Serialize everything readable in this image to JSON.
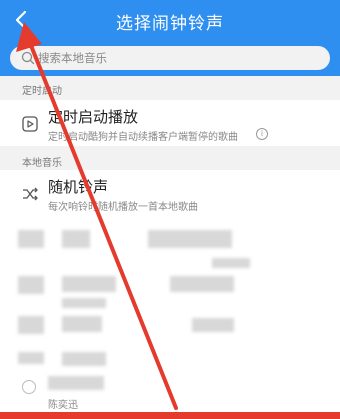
{
  "header": {
    "title": "选择闹钟铃声",
    "back_icon": "chevron-left-icon"
  },
  "search": {
    "placeholder": "搜索本地音乐",
    "icon": "search-icon"
  },
  "sections": {
    "timer": {
      "title": "定时启动",
      "item_title": "定时启动播放",
      "item_sub": "定时启动酷狗并自动续播客户端暂停的歌曲",
      "icon": "timer-play-icon",
      "info_icon": "info-icon"
    },
    "local": {
      "title": "本地音乐",
      "item_title": "随机铃声",
      "item_sub": "每次响铃时随机播放一首本地歌曲",
      "icon": "shuffle-icon"
    }
  },
  "contact": {
    "name": "陈奕迅"
  },
  "colors": {
    "header": "#2f8ff0",
    "bottom_bar": "#e53b2c",
    "annotation_arrow": "#e53b2c"
  }
}
